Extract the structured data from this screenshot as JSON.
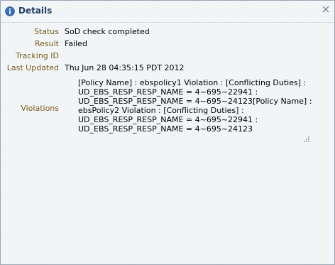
{
  "dialog": {
    "title": "Details",
    "close_icon": "close-x-icon",
    "title_icon": "info-icon"
  },
  "fields": {
    "status": {
      "label": "Status",
      "value": "SoD check completed"
    },
    "result": {
      "label": "Result",
      "value": "Failed"
    },
    "tracking_id": {
      "label": "Tracking ID",
      "value": ""
    },
    "last_updated": {
      "label": "Last Updated",
      "value": "Thu Jun 28 04:35:15 PDT 2012"
    },
    "violations": {
      "label": "Violations",
      "lines": [
        "[Policy Name] : ebspolicy1 Violation : [Conflicting Duties]  :",
        "UD_EBS_RESP_RESP_NAME = 4~695~22941  :",
        "UD_EBS_RESP_RESP_NAME = 4~695~24123[Policy Name] :",
        "ebsPolicy2 Violation : [Conflicting Duties]  :",
        "UD_EBS_RESP_RESP_NAME = 4~695~22941  :",
        "UD_EBS_RESP_RESP_NAME = 4~695~24123"
      ]
    }
  },
  "colors": {
    "label": "#7a5c1c",
    "title": "#1f3e62",
    "info_icon": "#3a73b8"
  }
}
